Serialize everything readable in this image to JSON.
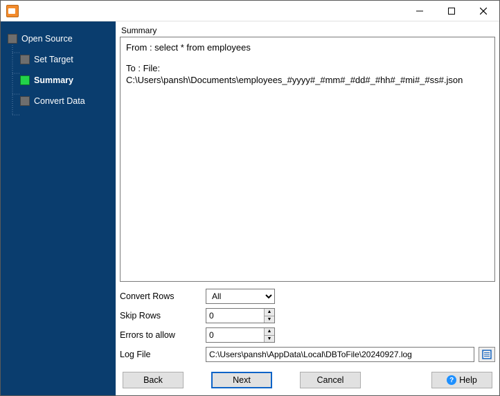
{
  "steps": {
    "open_source": "Open Source",
    "set_target": "Set Target",
    "summary": "Summary",
    "convert_data": "Convert Data"
  },
  "section_title": "Summary",
  "summary": {
    "from": "From : select * from employees",
    "to": "To : File: C:\\Users\\pansh\\Documents\\employees_#yyyy#_#mm#_#dd#_#hh#_#mi#_#ss#.json"
  },
  "options": {
    "convert_rows_label": "Convert Rows",
    "convert_rows_value": "All",
    "skip_rows_label": "Skip Rows",
    "skip_rows_value": "0",
    "errors_label": "Errors to allow",
    "errors_value": "0",
    "logfile_label": "Log File",
    "logfile_value": "C:\\Users\\pansh\\AppData\\Local\\DBToFile\\20240927.log"
  },
  "buttons": {
    "back": "Back",
    "next": "Next",
    "cancel": "Cancel",
    "help": "Help"
  }
}
